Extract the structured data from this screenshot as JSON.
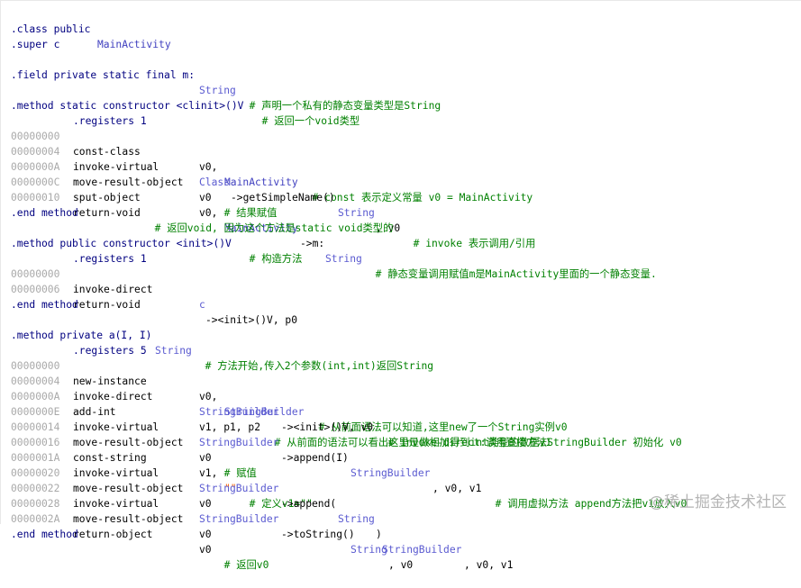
{
  "watermark": "@稀土掘金技术社区",
  "lines": {
    "l0": [
      ".class public ",
      "MainActivity"
    ],
    "l1": [
      ".super c"
    ],
    "l3": [
      ".field private static final m:",
      "String",
      "  # 声明一个私有的静态变量类型是String"
    ],
    "l5": [
      ".method static constructor <clinit>()V",
      "  # 返回一个void类型"
    ],
    "l6": [
      ".registers 1"
    ],
    "l7": [
      "00000000",
      "const-class",
      "v0, ",
      "MainActivity",
      "  # const 表示定义常量 v0 = MainActivity"
    ],
    "l8": [
      "00000004",
      "invoke-virtual",
      "Class",
      "->getSimpleName()",
      "String",
      ", v0",
      "  # invoke 表示调用/引用"
    ],
    "l9": [
      "0000000A",
      "move-result-object",
      "v0",
      "  # 结果赋值"
    ],
    "l10": [
      "0000000C",
      "sput-object",
      "v0, ",
      "MainActivity",
      "->m:",
      "String",
      "  # 静态变量调用赋值m是MainActivity里面的一个静态变量."
    ],
    "l11": [
      "00000010",
      "return-void",
      "  # 返回void, 因为这个方法是static void类型的"
    ],
    "l12": [
      ".end method"
    ],
    "l14": [
      ".method public constructor <init>()V",
      "  # 构造方法"
    ],
    "l15": [
      ".registers 1"
    ],
    "l16": [
      "00000000",
      "invoke-direct",
      "c",
      "-><init>()V, p0"
    ],
    "l17": [
      "00000006",
      "return-void"
    ],
    "l18": [
      ".end method"
    ],
    "l20": [
      ".method private a(I, I)",
      "String",
      "  # 方法开始,传入2个参数(int,int)返回String"
    ],
    "l21": [
      ".registers 5"
    ],
    "l22": [
      "00000000",
      "new-instance",
      "v0, ",
      "StringBuilder",
      "  # 从前面语法可以知道,这里new了一个String实例v0"
    ],
    "l23": [
      "00000004",
      "invoke-direct",
      "StringBuilder",
      "-><init>()V, v0",
      "  # invoke-direct:调用直接方法StringBuilder 初始化 v0"
    ],
    "l24": [
      "0000000A",
      "add-int",
      "v1, p1, p2",
      "  # 从前面的语法可以看出这里是做相加得到int类型的数据v1"
    ],
    "l25": [
      "0000000E",
      "invoke-virtual",
      "StringBuilder",
      "->append(I)",
      "StringBuilder",
      ", v0, v1",
      "  # 调用虚拟方法 append方法把v1放入v0"
    ],
    "l26": [
      "00000014",
      "move-result-object",
      "v0",
      "  # 赋值"
    ],
    "l27": [
      "00000016",
      "const-string",
      "v1, ",
      "\"\"",
      "  # 定义v1=\"\""
    ],
    "l28": [
      "0000001A",
      "invoke-virtual",
      "StringBuilder",
      "->append(",
      "String",
      ")",
      "StringBuilder",
      ", v0, v1"
    ],
    "l29": [
      "00000020",
      "move-result-object",
      "v0"
    ],
    "l30": [
      "00000022",
      "invoke-virtual",
      "StringBuilder",
      "->toString()",
      "String",
      ", v0"
    ],
    "l31": [
      "00000028",
      "move-result-object",
      "v0"
    ],
    "l32": [
      "0000002A",
      "return-object",
      "v0",
      "  # 返回v0"
    ],
    "l33": [
      ".end method"
    ]
  },
  "colors": {
    "keyword": "#000080",
    "type": "#5a5ad0",
    "comment": "#008000",
    "string": "#ff6600",
    "address": "#a9a9a9"
  }
}
